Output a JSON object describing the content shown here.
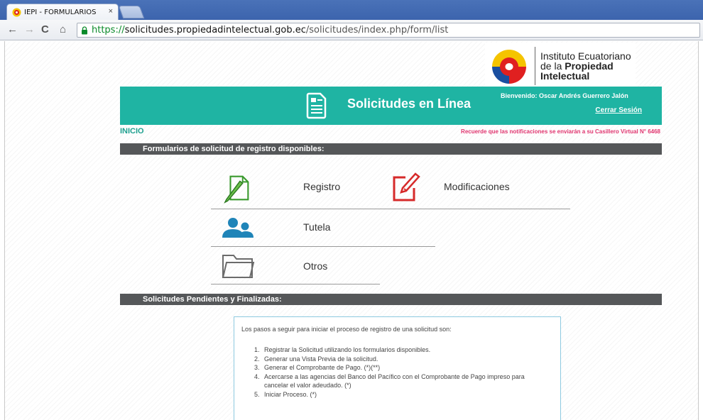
{
  "browser": {
    "tab_title": "IEPI - FORMULARIOS",
    "tab_close": "×",
    "url_scheme": "https://",
    "url_host": "solicitudes.propiedadintelectual.gob.ec",
    "url_path": "/solicitudes/index.php/form/list",
    "nav_back": "←",
    "nav_forward": "→",
    "nav_reload": "C",
    "nav_home": "⌂"
  },
  "logo": {
    "line1": "Instituto Ecuatoriano",
    "line2_prefix": "de la ",
    "line2_bold": "Propiedad",
    "line3": "Intelectual"
  },
  "header": {
    "title": "Solicitudes en Línea",
    "welcome": "Bienvenido: Oscar Andrés Guerrero Jalón",
    "logout": "Cerrar Sesión"
  },
  "breadcrumb": "INICIO",
  "notice": "Recuerde que las notificaciones se enviarán a su Casillero Virtual N° 6468",
  "sections": {
    "forms": "Formularios de solicitud de registro disponibles:",
    "pending": "Solicitudes Pendientes y Finalizadas:"
  },
  "forms": [
    {
      "label": "Registro",
      "icon": "pencil-document-icon",
      "color": "#3a9a2e"
    },
    {
      "label": "Modificaciones",
      "icon": "edit-document-icon",
      "color": "#d62a2a"
    },
    {
      "label": "Tutela",
      "icon": "users-icon",
      "color": "#1f84b8"
    },
    {
      "label": "Otros",
      "icon": "folder-icon",
      "color": "#6b6b6b"
    }
  ],
  "steps": {
    "intro": "Los pasos a seguir para iniciar el proceso de registro de una solicitud son:",
    "items": [
      "Registrar la Solicitud utilizando los formularios disponibles.",
      "Generar una Vista Previa de la solicitud.",
      "Generar el Comprobante de Pago. (*)(**)",
      "Acercarse a las agencias del Banco del Pacífico con el Comprobante de Pago impreso para cancelar el valor adeudado. (*)",
      "Iniciar Proceso. (*)"
    ]
  },
  "colors": {
    "teal": "#1fb4a3",
    "bar": "#555759",
    "notice": "#e0356f",
    "box_border": "#8dc9e0"
  }
}
